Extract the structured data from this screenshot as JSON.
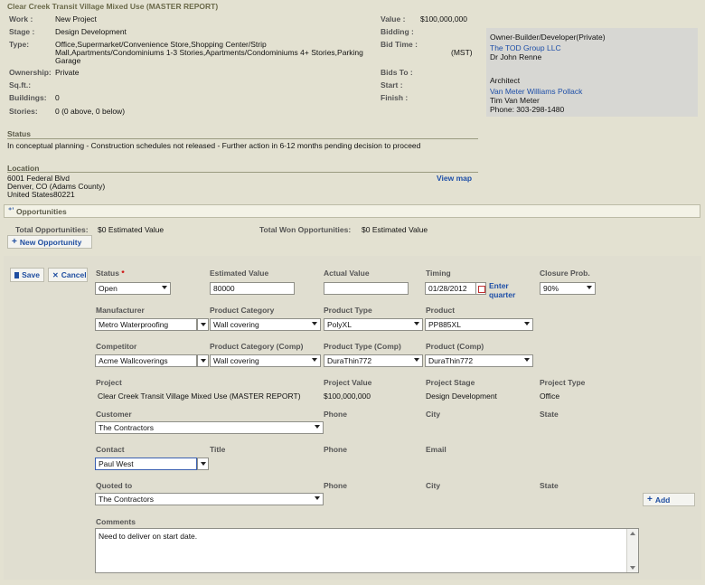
{
  "header": {
    "title": "Clear Creek Transit Village Mixed Use (MASTER REPORT)",
    "work_label": "Work :",
    "work_value": "New Project",
    "stage_label": "Stage :",
    "stage_value": "Design Development",
    "type_label": "Type:",
    "type_line1": "Office,Supermarket/Convenience Store,Shopping Center/Strip",
    "type_line2": "Mall,Apartments/Condominiums 1-3 Stories,Apartments/Condominiums 4+ Stories,Parking",
    "type_line3": "Garage",
    "ownership_label": "Ownership:",
    "ownership_value": "Private",
    "sqft_label": "Sq.ft.:",
    "buildings_label": "Buildings:",
    "buildings_value": "0",
    "stories_label": "Stories:",
    "stories_value": "0 (0 above, 0 below)",
    "value_label": "Value :",
    "value_value": "$100,000,000",
    "bidding_label": "Bidding :",
    "bidtime_label": "Bid Time :",
    "bidtime_value": "(MST)",
    "bidsto_label": "Bids To :",
    "start_label": "Start :",
    "finish_label": "Finish :"
  },
  "contacts": {
    "owner_heading": "Owner-Builder/Developer(Private)",
    "owner_company": "The TOD Group LLC",
    "owner_person": "Dr John Renne",
    "architect_heading": "Architect",
    "architect_company": "Van Meter Williams Pollack",
    "architect_person": "Tim Van Meter",
    "architect_phone": "Phone: 303-298-1480"
  },
  "status": {
    "heading": "Status",
    "text": "In conceptual planning - Construction schedules not released - Further action in 6-12 months pending decision to proceed"
  },
  "location": {
    "heading": "Location",
    "line1": "6001 Federal Blvd",
    "line2": "Denver, CO (Adams County)",
    "line3": "United States80221",
    "map_link": "View map"
  },
  "opportunities": {
    "tab_label": "Opportunities",
    "total_label": "Total Opportunities:",
    "total_value": "$0 Estimated Value",
    "won_label": "Total Won Opportunities:",
    "won_value": "$0 Estimated Value",
    "new_button": "New Opportunity"
  },
  "form": {
    "save": "Save",
    "cancel": "Cancel",
    "status_label": "Status",
    "required_mark": "*",
    "status_value": "Open",
    "est_label": "Estimated Value",
    "est_value": "80000",
    "actual_label": "Actual Value",
    "actual_value": "",
    "timing_label": "Timing",
    "timing_value": "01/28/2012",
    "enter_quarter": "Enter quarter",
    "closure_label": "Closure Prob.",
    "closure_value": "90%",
    "manufacturer_label": "Manufacturer",
    "manufacturer_value": "Metro Waterproofing",
    "prodcat_label": "Product Category",
    "prodcat_value": "Wall covering",
    "prodtype_label": "Product Type",
    "prodtype_value": "PolyXL",
    "product_label": "Product",
    "product_value": "PP885XL",
    "competitor_label": "Competitor",
    "competitor_value": "Acme Wallcoverings",
    "prodcat_comp_label": "Product Category (Comp)",
    "prodcat_comp_value": "Wall covering",
    "prodtype_comp_label": "Product Type (Comp)",
    "prodtype_comp_value": "DuraThin772",
    "product_comp_label": "Product (Comp)",
    "product_comp_value": "DuraThin772",
    "project_label": "Project",
    "project_value": "Clear Creek Transit Village Mixed Use (MASTER REPORT)",
    "projvalue_label": "Project Value",
    "projvalue_value": "$100,000,000",
    "projstage_label": "Project Stage",
    "projstage_value": "Design Development",
    "projtype_label": "Project Type",
    "projtype_value": "Office",
    "customer_label": "Customer",
    "customer_value": "The Contractors",
    "phone_label": "Phone",
    "city_label": "City",
    "state_label": "State",
    "contact_label": "Contact",
    "contact_value": "Paul West",
    "title_label": "Title",
    "email_label": "Email",
    "quoted_label": "Quoted to",
    "quoted_value": "The Contractors",
    "add_button": "Add",
    "comments_label": "Comments",
    "comments_value": "Need to deliver on start date."
  }
}
